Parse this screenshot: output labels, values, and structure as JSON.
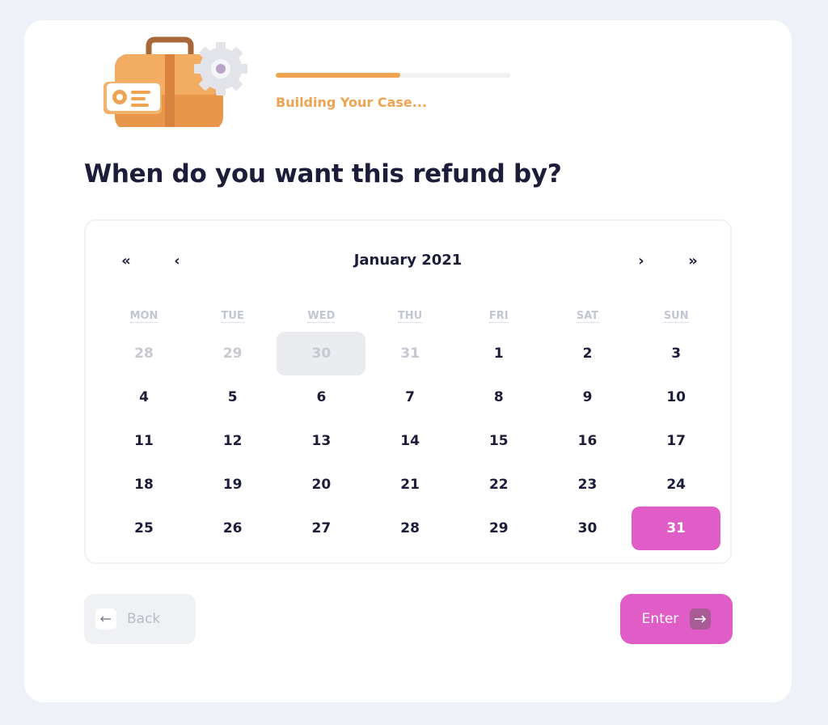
{
  "progress": {
    "label": "Building Your Case...",
    "fraction": 0.53
  },
  "question": "When do you want this refund by?",
  "calendar": {
    "nav": {
      "prev_year": "«",
      "prev_month": "‹",
      "next_month": "›",
      "next_year": "»"
    },
    "month_label": "January 2021",
    "weekdays": [
      "MON",
      "TUE",
      "WED",
      "THU",
      "FRI",
      "SAT",
      "SUN"
    ],
    "weeks": [
      [
        {
          "d": "28",
          "m": true
        },
        {
          "d": "29",
          "m": true
        },
        {
          "d": "30",
          "m": true,
          "h": true
        },
        {
          "d": "31",
          "m": true
        },
        {
          "d": "1"
        },
        {
          "d": "2"
        },
        {
          "d": "3"
        }
      ],
      [
        {
          "d": "4"
        },
        {
          "d": "5"
        },
        {
          "d": "6"
        },
        {
          "d": "7"
        },
        {
          "d": "8"
        },
        {
          "d": "9"
        },
        {
          "d": "10"
        }
      ],
      [
        {
          "d": "11"
        },
        {
          "d": "12"
        },
        {
          "d": "13"
        },
        {
          "d": "14"
        },
        {
          "d": "15"
        },
        {
          "d": "16"
        },
        {
          "d": "17"
        }
      ],
      [
        {
          "d": "18"
        },
        {
          "d": "19"
        },
        {
          "d": "20"
        },
        {
          "d": "21"
        },
        {
          "d": "22"
        },
        {
          "d": "23"
        },
        {
          "d": "24"
        }
      ],
      [
        {
          "d": "25"
        },
        {
          "d": "26"
        },
        {
          "d": "27"
        },
        {
          "d": "28"
        },
        {
          "d": "29"
        },
        {
          "d": "30"
        },
        {
          "d": "31",
          "s": true
        }
      ]
    ]
  },
  "buttons": {
    "back": "Back",
    "enter": "Enter"
  },
  "icons": {
    "illustration": "briefcase-gear-illustration",
    "back": "arrow-left-icon",
    "enter": "arrow-right-icon"
  },
  "colors": {
    "accent": "#e05cc6",
    "progress": "#f0a350",
    "text": "#1d1d3a"
  }
}
